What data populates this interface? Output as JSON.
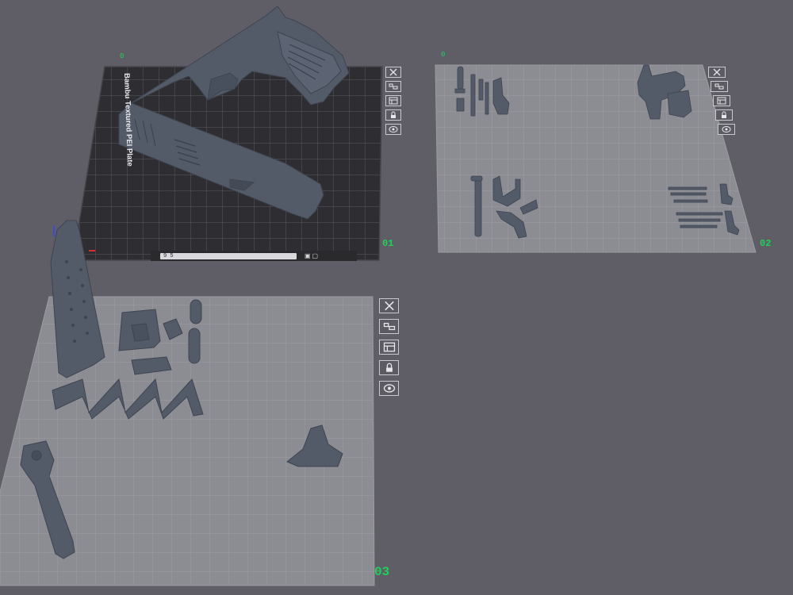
{
  "plates": [
    {
      "number": "01",
      "label": "Bambu Textured PEI Plate",
      "corner": "0",
      "type_code": "9 5",
      "status": "▣▢"
    },
    {
      "number": "02",
      "corner": "0"
    },
    {
      "number": "03"
    }
  ],
  "plate_tools": [
    {
      "name": "delete-plate",
      "icon": "close-icon"
    },
    {
      "name": "arrange",
      "icon": "arrange-icon"
    },
    {
      "name": "plate-settings",
      "icon": "layout-icon"
    },
    {
      "name": "lock-plate",
      "icon": "lock-icon"
    },
    {
      "name": "slice-plate",
      "icon": "eye-icon"
    }
  ],
  "colors": {
    "background": "#5f5e66",
    "plate_dark": "#2e2d31",
    "plate_light": "#8c8c93",
    "part": "#535a68",
    "accent": "#1fd15a"
  }
}
